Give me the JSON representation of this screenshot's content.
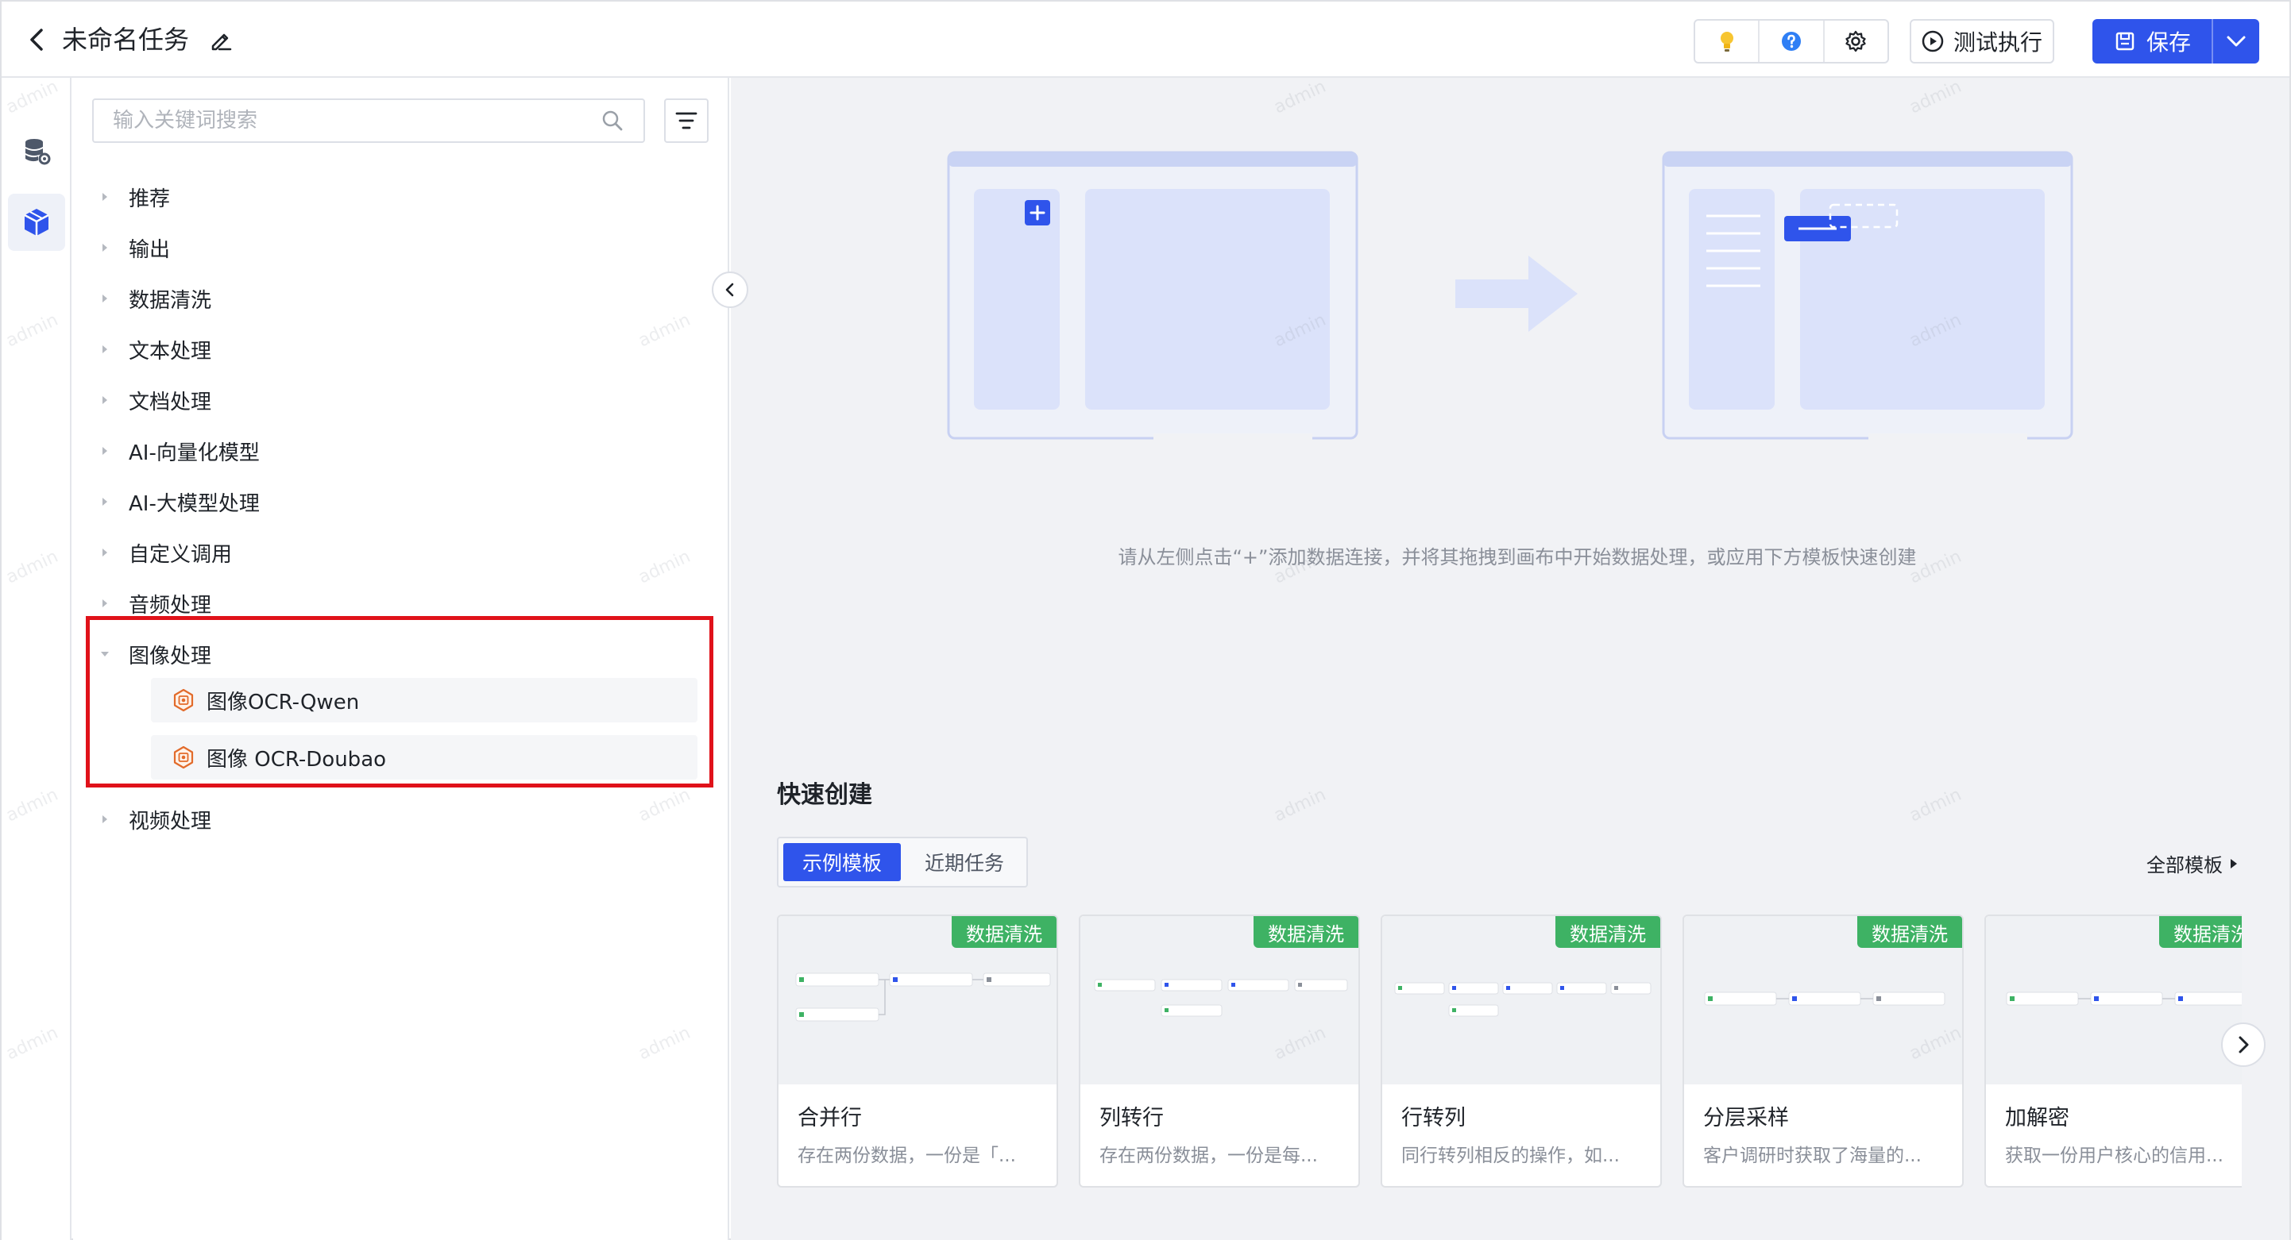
{
  "header": {
    "title": "未命名任务",
    "run_label": "测试执行",
    "save_label": "保存"
  },
  "panel": {
    "search_placeholder": "输入关键词搜索",
    "tree": [
      {
        "label": "推荐",
        "expanded": false
      },
      {
        "label": "输出",
        "expanded": false
      },
      {
        "label": "数据清洗",
        "expanded": false
      },
      {
        "label": "文本处理",
        "expanded": false
      },
      {
        "label": "文档处理",
        "expanded": false
      },
      {
        "label": "AI-向量化模型",
        "expanded": false
      },
      {
        "label": "AI-大模型处理",
        "expanded": false
      },
      {
        "label": "自定义调用",
        "expanded": false
      },
      {
        "label": "音频处理",
        "expanded": false
      },
      {
        "label": "图像处理",
        "expanded": true,
        "children": [
          "图像OCR-Qwen",
          "图像 OCR-Doubao"
        ]
      },
      {
        "label": "视频处理",
        "expanded": false
      }
    ]
  },
  "canvas": {
    "hint": "请从左侧点击“+”添加数据连接，并将其拖拽到画布中开始数据处理，或应用下方模板快速创建",
    "quick_create_title": "快速创建",
    "tabs": [
      {
        "label": "示例模板",
        "active": true
      },
      {
        "label": "近期任务",
        "active": false
      }
    ],
    "all_templates_label": "全部模板",
    "cards": [
      {
        "tag": "数据清洗",
        "title": "合并行",
        "desc": "存在两份数据，一份是「..."
      },
      {
        "tag": "数据清洗",
        "title": "列转行",
        "desc": "存在两份数据，一份是每..."
      },
      {
        "tag": "数据清洗",
        "title": "行转列",
        "desc": "同行转列相反的操作，如..."
      },
      {
        "tag": "数据清洗",
        "title": "分层采样",
        "desc": "客户调研时获取了海量的..."
      },
      {
        "tag": "数据清洗",
        "title": "加解密",
        "desc": "获取一份用户核心的信用..."
      }
    ]
  },
  "watermark": "admin",
  "colors": {
    "primary": "#2f54eb",
    "tag_green": "#3eb264",
    "highlight_red": "#e0121a",
    "canvas_bg": "#f1f2f5"
  }
}
